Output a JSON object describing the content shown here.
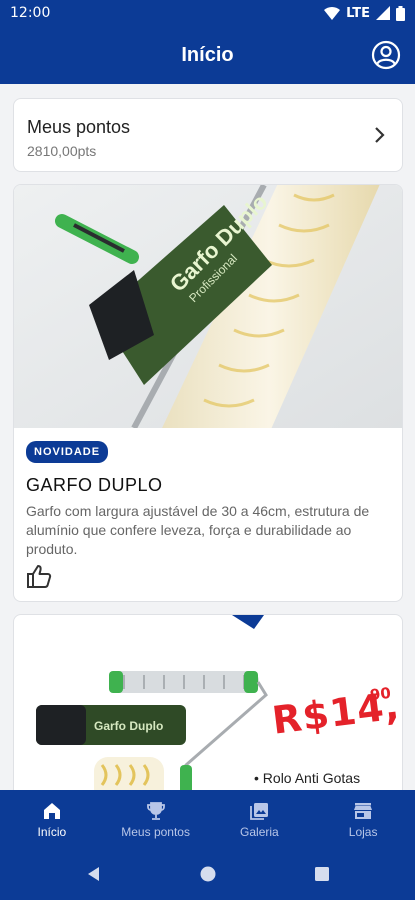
{
  "status_bar": {
    "time": "12:00",
    "network": "LTE"
  },
  "app_bar": {
    "title": "Início"
  },
  "points": {
    "label": "Meus pontos",
    "value": "2810,00pts"
  },
  "news": {
    "badge": "NOVIDADE",
    "title": "GARFO DUPLO",
    "description": "Garfo com largura ajustável de 30 a 46cm, estrutura de alumínio que confere leveza, força e durabilidade ao produto.",
    "package_text": "Garfo Duplo",
    "package_subtext": "Profissional"
  },
  "promo": {
    "price": "R$14,",
    "cents": "90",
    "feature": "• Rolo Anti Gotas",
    "package_text": "Garfo Duplo"
  },
  "bottom_nav": {
    "items": [
      {
        "label": "Início",
        "icon": "home-icon",
        "active": true
      },
      {
        "label": "Meus pontos",
        "icon": "trophy-icon",
        "active": false
      },
      {
        "label": "Galeria",
        "icon": "gallery-icon",
        "active": false
      },
      {
        "label": "Lojas",
        "icon": "store-icon",
        "active": false
      }
    ]
  },
  "colors": {
    "primary": "#0c3b96",
    "accent_red": "#e4222a",
    "brand_green": "#3fb24f"
  }
}
